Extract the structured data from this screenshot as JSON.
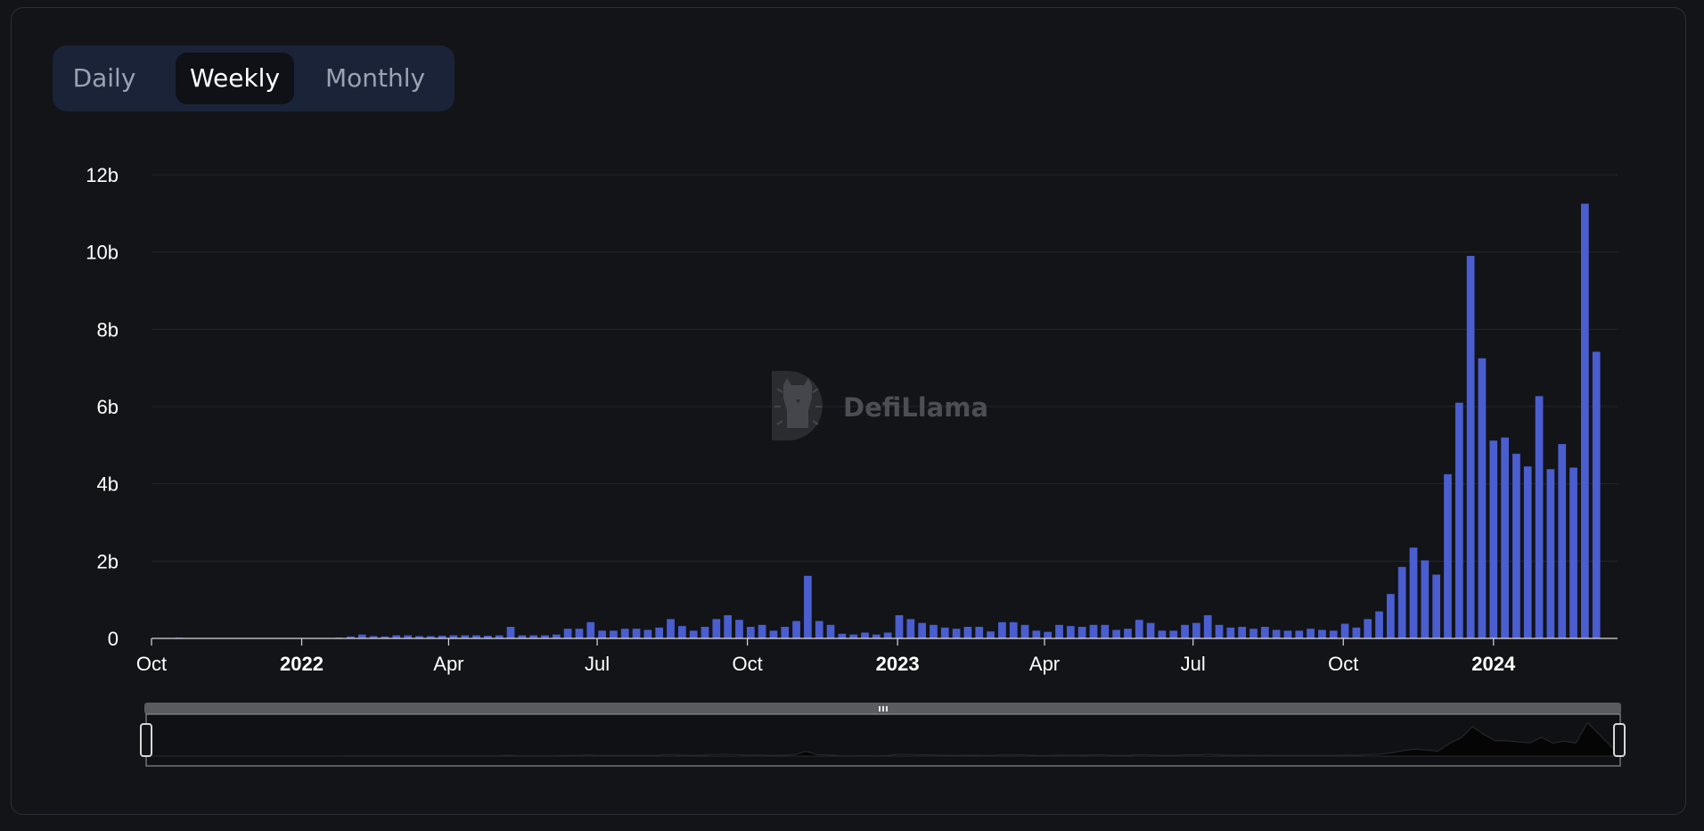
{
  "toggle": {
    "options": [
      "Daily",
      "Weekly",
      "Monthly"
    ],
    "selected": "Weekly"
  },
  "watermark": {
    "text": "DefiLlama"
  },
  "colors": {
    "background": "#131418",
    "bar": "#4a5ed0",
    "grid": "#24262c",
    "axis_text": "#ffffff"
  },
  "chart_data": {
    "type": "bar",
    "title": "",
    "xlabel": "",
    "ylabel": "",
    "y_unit": "b",
    "ylim": [
      0,
      12
    ],
    "yticks": [
      0,
      2,
      4,
      6,
      8,
      10,
      12
    ],
    "ytick_labels": [
      "0",
      "2b",
      "4b",
      "6b",
      "8b",
      "10b",
      "12b"
    ],
    "xlim": [
      "2021-10-01",
      "2024-03-17"
    ],
    "xticks": [
      {
        "date": "2021-10-01",
        "label": "Oct",
        "bold": false
      },
      {
        "date": "2022-01-01",
        "label": "2022",
        "bold": true
      },
      {
        "date": "2022-04-01",
        "label": "Apr",
        "bold": false
      },
      {
        "date": "2022-07-01",
        "label": "Jul",
        "bold": false
      },
      {
        "date": "2022-10-01",
        "label": "Oct",
        "bold": false
      },
      {
        "date": "2023-01-01",
        "label": "2023",
        "bold": true
      },
      {
        "date": "2023-04-01",
        "label": "Apr",
        "bold": false
      },
      {
        "date": "2023-07-01",
        "label": "Jul",
        "bold": false
      },
      {
        "date": "2023-10-01",
        "label": "Oct",
        "bold": false
      },
      {
        "date": "2024-01-01",
        "label": "2024",
        "bold": true
      }
    ],
    "grid": true,
    "legend": "none",
    "series": [
      {
        "values": [
          [
            "2021-10-04",
            0.0
          ],
          [
            "2021-10-11",
            0.0
          ],
          [
            "2021-10-18",
            0.02
          ],
          [
            "2021-10-25",
            0.01
          ],
          [
            "2021-11-01",
            0.0
          ],
          [
            "2021-11-08",
            0.0
          ],
          [
            "2021-11-15",
            0.0
          ],
          [
            "2021-11-22",
            0.0
          ],
          [
            "2021-11-29",
            0.0
          ],
          [
            "2021-12-06",
            0.0
          ],
          [
            "2021-12-13",
            0.0
          ],
          [
            "2021-12-20",
            0.0
          ],
          [
            "2021-12-27",
            0.0
          ],
          [
            "2022-01-03",
            0.0
          ],
          [
            "2022-01-10",
            0.0
          ],
          [
            "2022-01-17",
            0.01
          ],
          [
            "2022-01-24",
            0.02
          ],
          [
            "2022-01-31",
            0.05
          ],
          [
            "2022-02-07",
            0.1
          ],
          [
            "2022-02-14",
            0.06
          ],
          [
            "2022-02-21",
            0.05
          ],
          [
            "2022-02-28",
            0.08
          ],
          [
            "2022-03-07",
            0.08
          ],
          [
            "2022-03-14",
            0.06
          ],
          [
            "2022-03-21",
            0.06
          ],
          [
            "2022-03-28",
            0.07
          ],
          [
            "2022-04-04",
            0.08
          ],
          [
            "2022-04-11",
            0.08
          ],
          [
            "2022-04-18",
            0.08
          ],
          [
            "2022-04-25",
            0.07
          ],
          [
            "2022-05-02",
            0.08
          ],
          [
            "2022-05-09",
            0.3
          ],
          [
            "2022-05-16",
            0.08
          ],
          [
            "2022-05-23",
            0.08
          ],
          [
            "2022-05-30",
            0.08
          ],
          [
            "2022-06-06",
            0.1
          ],
          [
            "2022-06-13",
            0.25
          ],
          [
            "2022-06-20",
            0.25
          ],
          [
            "2022-06-27",
            0.42
          ],
          [
            "2022-07-04",
            0.2
          ],
          [
            "2022-07-11",
            0.2
          ],
          [
            "2022-07-18",
            0.25
          ],
          [
            "2022-07-25",
            0.25
          ],
          [
            "2022-08-01",
            0.22
          ],
          [
            "2022-08-08",
            0.28
          ],
          [
            "2022-08-15",
            0.5
          ],
          [
            "2022-08-22",
            0.32
          ],
          [
            "2022-08-29",
            0.2
          ],
          [
            "2022-09-05",
            0.3
          ],
          [
            "2022-09-12",
            0.5
          ],
          [
            "2022-09-19",
            0.6
          ],
          [
            "2022-09-26",
            0.48
          ],
          [
            "2022-10-03",
            0.3
          ],
          [
            "2022-10-10",
            0.35
          ],
          [
            "2022-10-17",
            0.2
          ],
          [
            "2022-10-24",
            0.3
          ],
          [
            "2022-10-31",
            0.45
          ],
          [
            "2022-11-07",
            1.62
          ],
          [
            "2022-11-14",
            0.45
          ],
          [
            "2022-11-21",
            0.35
          ],
          [
            "2022-11-28",
            0.12
          ],
          [
            "2022-12-05",
            0.1
          ],
          [
            "2022-12-12",
            0.15
          ],
          [
            "2022-12-19",
            0.1
          ],
          [
            "2022-12-26",
            0.15
          ],
          [
            "2023-01-02",
            0.6
          ],
          [
            "2023-01-09",
            0.5
          ],
          [
            "2023-01-16",
            0.4
          ],
          [
            "2023-01-23",
            0.35
          ],
          [
            "2023-01-30",
            0.28
          ],
          [
            "2023-02-06",
            0.25
          ],
          [
            "2023-02-13",
            0.3
          ],
          [
            "2023-02-20",
            0.3
          ],
          [
            "2023-02-27",
            0.18
          ],
          [
            "2023-03-06",
            0.42
          ],
          [
            "2023-03-13",
            0.42
          ],
          [
            "2023-03-20",
            0.35
          ],
          [
            "2023-03-27",
            0.2
          ],
          [
            "2023-04-03",
            0.17
          ],
          [
            "2023-04-10",
            0.35
          ],
          [
            "2023-04-17",
            0.32
          ],
          [
            "2023-04-24",
            0.3
          ],
          [
            "2023-05-01",
            0.35
          ],
          [
            "2023-05-08",
            0.35
          ],
          [
            "2023-05-15",
            0.22
          ],
          [
            "2023-05-22",
            0.25
          ],
          [
            "2023-05-29",
            0.48
          ],
          [
            "2023-06-05",
            0.4
          ],
          [
            "2023-06-12",
            0.2
          ],
          [
            "2023-06-19",
            0.2
          ],
          [
            "2023-06-26",
            0.35
          ],
          [
            "2023-07-03",
            0.4
          ],
          [
            "2023-07-10",
            0.6
          ],
          [
            "2023-07-17",
            0.35
          ],
          [
            "2023-07-24",
            0.28
          ],
          [
            "2023-07-31",
            0.3
          ],
          [
            "2023-08-07",
            0.25
          ],
          [
            "2023-08-14",
            0.3
          ],
          [
            "2023-08-21",
            0.22
          ],
          [
            "2023-08-28",
            0.2
          ],
          [
            "2023-09-04",
            0.2
          ],
          [
            "2023-09-11",
            0.25
          ],
          [
            "2023-09-18",
            0.22
          ],
          [
            "2023-09-25",
            0.2
          ],
          [
            "2023-10-02",
            0.38
          ],
          [
            "2023-10-09",
            0.28
          ],
          [
            "2023-10-16",
            0.5
          ],
          [
            "2023-10-23",
            0.7
          ],
          [
            "2023-10-30",
            1.15
          ],
          [
            "2023-11-06",
            1.85
          ],
          [
            "2023-11-13",
            2.35
          ],
          [
            "2023-11-20",
            2.02
          ],
          [
            "2023-11-27",
            1.65
          ],
          [
            "2023-12-04",
            4.25
          ],
          [
            "2023-12-11",
            6.1
          ],
          [
            "2023-12-18",
            9.9
          ],
          [
            "2023-12-25",
            7.25
          ],
          [
            "2024-01-01",
            5.12
          ],
          [
            "2024-01-08",
            5.2
          ],
          [
            "2024-01-15",
            4.78
          ],
          [
            "2024-01-22",
            4.45
          ],
          [
            "2024-01-29",
            6.27
          ],
          [
            "2024-02-05",
            4.38
          ],
          [
            "2024-02-12",
            5.03
          ],
          [
            "2024-02-19",
            4.42
          ],
          [
            "2024-02-26",
            11.25
          ],
          [
            "2024-03-04",
            7.42
          ]
        ]
      }
    ]
  }
}
